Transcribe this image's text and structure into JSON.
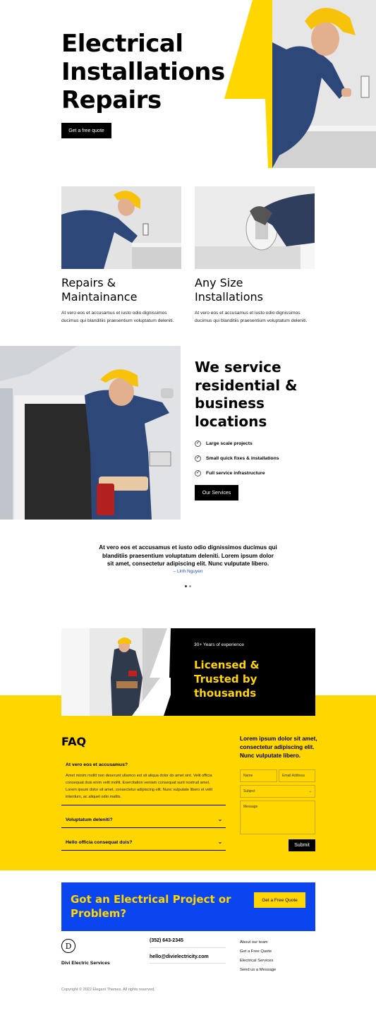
{
  "hero": {
    "title": "Electrical Installations & Repairs",
    "button_label": "Get a free quote"
  },
  "cards": [
    {
      "title": "Repairs & Maintainance",
      "text": "At vero eos et accusamus et iusto odio dignissimos ducimus qui blanditiis praesentium voluptatum deleniti."
    },
    {
      "title": "Any Size Installations",
      "text": "At vero eos et accusamus et iusto odio dignissimos ducimus qui blanditiis praesentium voluptatum deleniti."
    }
  ],
  "services": {
    "title": "We service residential & business locations",
    "items": [
      "Large scale projects",
      "Small quick fixes & installations",
      "Full service infrastructure"
    ],
    "button_label": "Our Services"
  },
  "testimonial": {
    "quote": "At vero eos et accusamus et iusto odio dignissimos ducimus qui blanditiis praesentium voluptatum deleniti. Lorem ipsum dolor sit amet, consectetur adipiscing elit. Nunc vulputate libero.",
    "author": "– Linh Nguyen"
  },
  "licensed": {
    "eyebrow": "30+ Years of experience",
    "title": "Licensed & Trusted by thousands"
  },
  "faq": {
    "title": "FAQ",
    "items": [
      {
        "question": "At vero eos et accusamus?",
        "answer": "Amet minim mollit non deserunt ullamco est sit aliqua dolor do amet sint. Velit officia consequat duis enim velit mollit. Exercitation veniam consequat sunt nostrud amet. Lorem ipsum dolor sit amet, consectetur adipiscing elit. Nunc vulputate libero et velit interdum, ac aliquet odio mattis."
      },
      {
        "question": "Voluptatum deleniti?"
      },
      {
        "question": "Hello officia consequat duis?"
      }
    ]
  },
  "form": {
    "title": "Lorem ipsum dolor sit amet, consectetur adipiscing elit. Nunc vulputate libero.",
    "name_placeholder": "Name",
    "email_placeholder": "Email Address",
    "subject_placeholder": "Subject",
    "message_placeholder": "Message",
    "submit_label": "Submit"
  },
  "cta": {
    "title": "Got an Electrical Project or Problem?",
    "button_label": "Get a Free Quote"
  },
  "footer": {
    "logo_letter": "D",
    "brand": "Divi Electric Services",
    "phone": "(352) 643-2345",
    "email": "hello@divielectricity.com",
    "links": [
      "About our team",
      "Get a Free Quote",
      "Electrical Services",
      "Send us a Message"
    ],
    "copyright": "Copyright © 2022 Elegant Themes. All rights reserved."
  },
  "colors": {
    "accent_yellow": "#ffd600",
    "cta_blue": "#0a45f0",
    "black": "#000000"
  }
}
